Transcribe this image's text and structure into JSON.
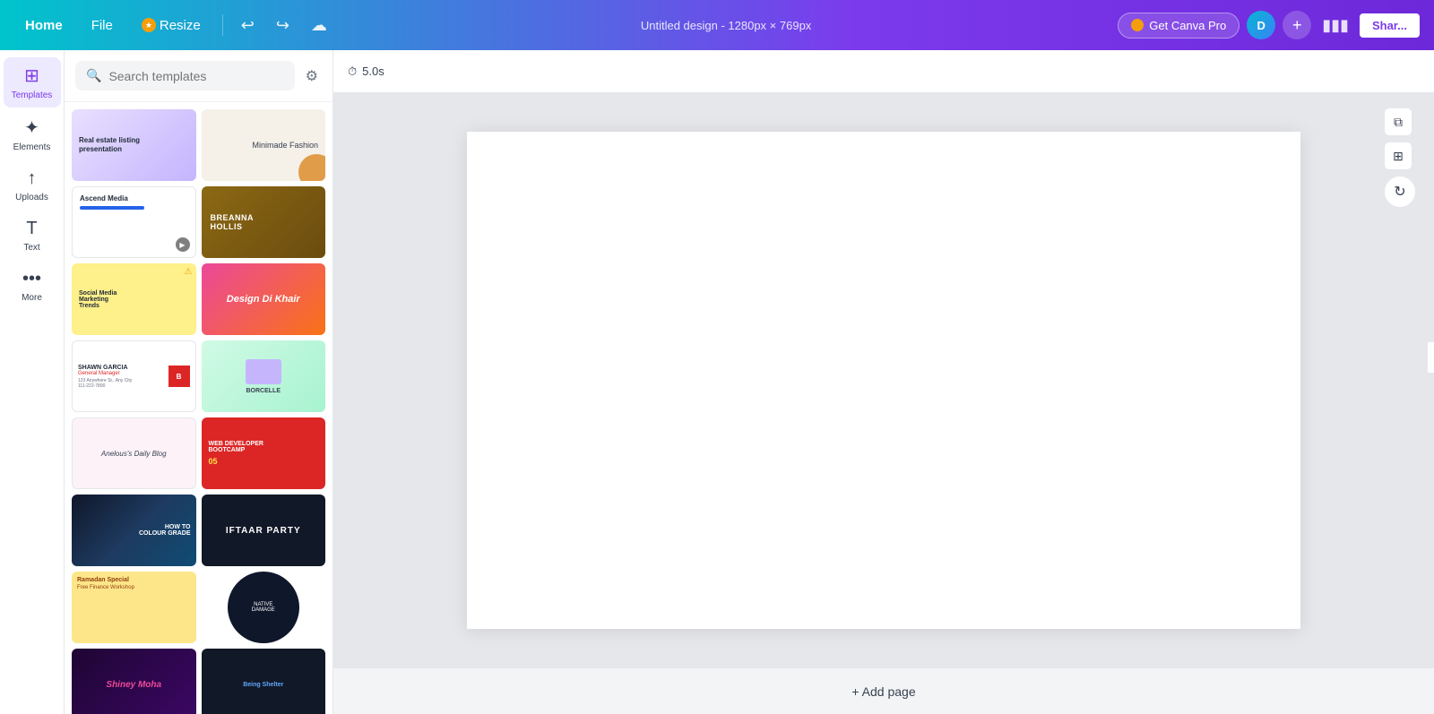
{
  "topnav": {
    "home_label": "Home",
    "file_label": "File",
    "resize_label": "Resize",
    "design_title": "Untitled design - 1280px × 769px",
    "get_pro_label": "Get Canva Pro",
    "share_label": "Shar...",
    "avatar_initials": "D",
    "timer_label": "5.0s"
  },
  "sidebar": {
    "items": [
      {
        "id": "templates",
        "label": "Templates",
        "icon": "⊞"
      },
      {
        "id": "elements",
        "label": "Elements",
        "icon": "✦"
      },
      {
        "id": "uploads",
        "label": "Uploads",
        "icon": "↑"
      },
      {
        "id": "text",
        "label": "Text",
        "icon": "T"
      },
      {
        "id": "more",
        "label": "More",
        "icon": "⋯"
      }
    ]
  },
  "templates_panel": {
    "search_placeholder": "Search templates",
    "templates": [
      {
        "id": "real-estate",
        "title": "Real estate listing presentation",
        "style": "purple-gradient"
      },
      {
        "id": "minimade",
        "title": "Minimade Fashion",
        "style": "beige"
      },
      {
        "id": "ascend-media",
        "title": "Ascend Media",
        "style": "white-blue"
      },
      {
        "id": "breanna",
        "title": "Breanna Hollis",
        "style": "brown"
      },
      {
        "id": "social-media",
        "title": "Social Media Marketing Trends",
        "style": "yellow"
      },
      {
        "id": "design-dkhair",
        "title": "Design Di Khair",
        "style": "pink-orange"
      },
      {
        "id": "shawn-garcia",
        "title": "Shawn Garcia",
        "style": "white-red"
      },
      {
        "id": "borcelle",
        "title": "Borcelle",
        "style": "green-purple"
      },
      {
        "id": "daily-blog",
        "title": "Anelous Daily Blog",
        "style": "light-pink"
      },
      {
        "id": "web-dev",
        "title": "Web Developer Bootcamp",
        "style": "red"
      },
      {
        "id": "how-to",
        "title": "How to Colour Grade",
        "style": "dark-lake"
      },
      {
        "id": "iftaar",
        "title": "Iftaar Party",
        "style": "dark-food"
      },
      {
        "id": "ramadan",
        "title": "Ramadan Special",
        "style": "yellow-food"
      },
      {
        "id": "circle",
        "title": "Native Damage",
        "style": "dark-circle"
      },
      {
        "id": "shiney",
        "title": "Shiney Moha",
        "style": "dark-pink"
      },
      {
        "id": "dark-card",
        "title": "Being Shelter",
        "style": "dark-person"
      }
    ]
  },
  "canvas": {
    "add_page_label": "+ Add page"
  }
}
